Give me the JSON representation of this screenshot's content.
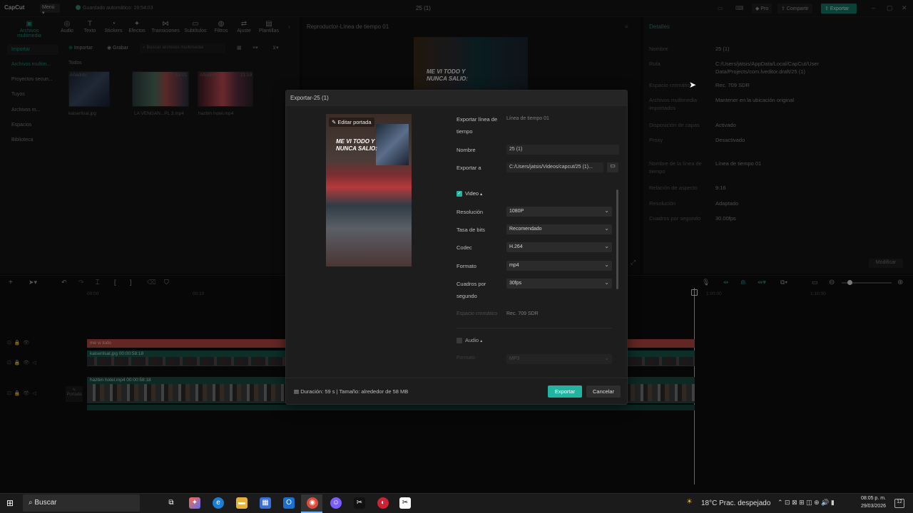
{
  "app": {
    "logo": "CapCut",
    "menu_label": "Menú",
    "autosave": "Guardado automático: 19:54:03",
    "project_title": "25 (1)",
    "pro_label": "Pro",
    "share_label": "Compartir",
    "export_label": "Exportar"
  },
  "toolbar": [
    {
      "label": "Archivos multimedia",
      "icon": "media"
    },
    {
      "label": "Audio",
      "icon": "audio"
    },
    {
      "label": "Texto",
      "icon": "text"
    },
    {
      "label": "Stickers",
      "icon": "sticker"
    },
    {
      "label": "Efectos",
      "icon": "effects"
    },
    {
      "label": "Transiciones",
      "icon": "transition"
    },
    {
      "label": "Subtítulos",
      "icon": "subtitles"
    },
    {
      "label": "Filtros",
      "icon": "filter"
    },
    {
      "label": "Ajuste",
      "icon": "adjust"
    },
    {
      "label": "Plantillas",
      "icon": "templates"
    }
  ],
  "sidebar": {
    "import_label": "Importar",
    "items": [
      "Archivos multim...",
      "Proyectos secun...",
      "Tuyos",
      "Archivos m...",
      "Espacios",
      "Biblioteca"
    ]
  },
  "media": {
    "import_btn": "Importar",
    "record_btn": "Grabar",
    "search_placeholder": "Buscar archivos multimedia",
    "all_label": "Todos",
    "items": [
      {
        "tag": "Añadido",
        "name": "kaiserlisal.jpg",
        "duration": ""
      },
      {
        "tag": "",
        "name": "LA VENGAN...PL 3.mp4",
        "duration": "10:01"
      },
      {
        "tag": "Añadido",
        "name": "hazbin hotel.mp4",
        "duration": "21:19"
      }
    ]
  },
  "player": {
    "title": "Reproductor-Línea de tiempo 01"
  },
  "details": {
    "title": "Detalles",
    "rows": [
      {
        "label": "Nombre",
        "value": "25 (1)"
      },
      {
        "label": "Ruta",
        "value": "C:/Users/jatsis/AppData/Local/CapCut/User Data/Projects/com.lveditor.draft/25 (1)"
      },
      {
        "label": "Espacio cromático",
        "value": "Rec. 709 SDR"
      },
      {
        "label": "Archivos multimedia importados",
        "value": "Mantener en la ubicación original"
      },
      {
        "label": "Disposición de capas",
        "value": "Activado"
      },
      {
        "label": "Proxy",
        "value": "Desactivado"
      },
      {
        "label": "Nombre de la línea de tiempo",
        "value": "Línea de tiempo 01"
      },
      {
        "label": "Relación de aspecto",
        "value": "9:16"
      },
      {
        "label": "Resolución",
        "value": "Adaptado"
      },
      {
        "label": "Cuadros por segundo",
        "value": "30.00fps"
      }
    ],
    "modify_btn": "Modificar"
  },
  "timeline": {
    "ticks": [
      "00:00",
      "00:10",
      "1:00:00",
      "1:10:00"
    ],
    "text_clip": "me vi todo",
    "clip1": "kaiserlisal.jpg   00:00:58:18",
    "clip2": "hazbin hotel.mp4   00:00:58:18",
    "cover_label": "Portada"
  },
  "dialog": {
    "title": "Exportar-25 (1)",
    "edit_cover": "Editar portada",
    "cover_text": "ME VI TODO Y NUNCA SALIO:",
    "export_timeline_label": "Exportar línea de tiempo",
    "export_timeline_value": "Línea de tiempo 01",
    "name_label": "Nombre",
    "name_value": "25 (1)",
    "export_to_label": "Exportar a",
    "export_to_value": "C:/Users/jatsis/Videos/capcut/25 (1)...",
    "video_label": "Video",
    "resolution_label": "Resolución",
    "resolution_value": "1080P",
    "bitrate_label": "Tasa de bits",
    "bitrate_value": "Recomendado",
    "codec_label": "Codec",
    "codec_value": "H.264",
    "format_label": "Formato",
    "format_value": "mp4",
    "fps_label": "Cuadros por segundo",
    "fps_value": "30fps",
    "colorspace_label": "Espacio cromático",
    "colorspace_value": "Rec. 709 SDR",
    "audio_label": "Audio",
    "audio_format_label": "Formato",
    "audio_format_value": "MP3",
    "footer_info": "Duración: 59 s | Tamaño: alrededor de 58 MB",
    "export_btn": "Exportar",
    "cancel_btn": "Cancelar"
  },
  "taskbar": {
    "search_label": "Buscar",
    "weather": "18°C  Prac. despejado",
    "time": "08:05 p. m.",
    "date": "29/03/2026",
    "notif_count": "12"
  },
  "colors": {
    "accent": "#137869",
    "accent_bright": "#21b4a0"
  }
}
